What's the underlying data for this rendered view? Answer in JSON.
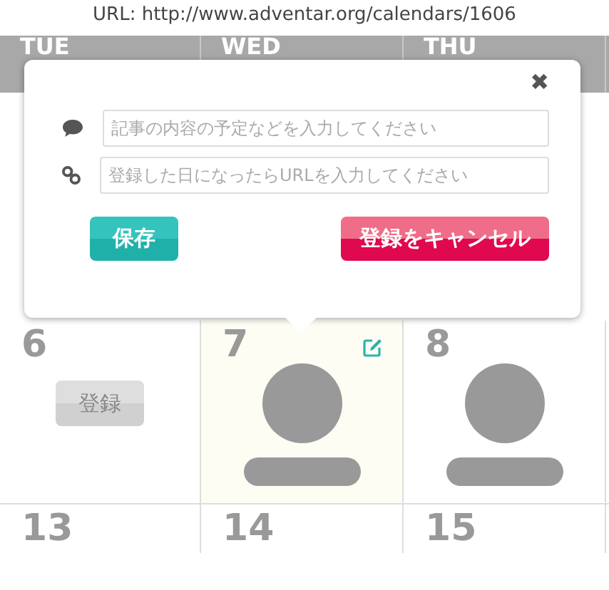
{
  "caption": "URL: http://www.adventar.org/calendars/1606",
  "weekdays": [
    "TUE",
    "WED",
    "THU"
  ],
  "weeks": [
    {
      "days": [
        {
          "date": "6",
          "selected": false,
          "kind": "open",
          "button": "登録",
          "editable": false
        },
        {
          "date": "7",
          "selected": true,
          "kind": "taken",
          "editable": true
        },
        {
          "date": "8",
          "selected": false,
          "kind": "taken",
          "editable": false
        }
      ]
    },
    {
      "days": [
        {
          "date": "13",
          "selected": false,
          "kind": "blank",
          "editable": false
        },
        {
          "date": "14",
          "selected": false,
          "kind": "blank",
          "editable": false
        },
        {
          "date": "15",
          "selected": false,
          "kind": "blank",
          "editable": false
        }
      ]
    }
  ],
  "popup": {
    "close": "✖",
    "fields": [
      {
        "kind": "comment",
        "placeholder": "記事の内容の予定などを入力してください"
      },
      {
        "kind": "link",
        "placeholder": "登録した日になったらURLを入力してください"
      }
    ],
    "save": "保存",
    "cancel": "登録をキャンセル"
  }
}
